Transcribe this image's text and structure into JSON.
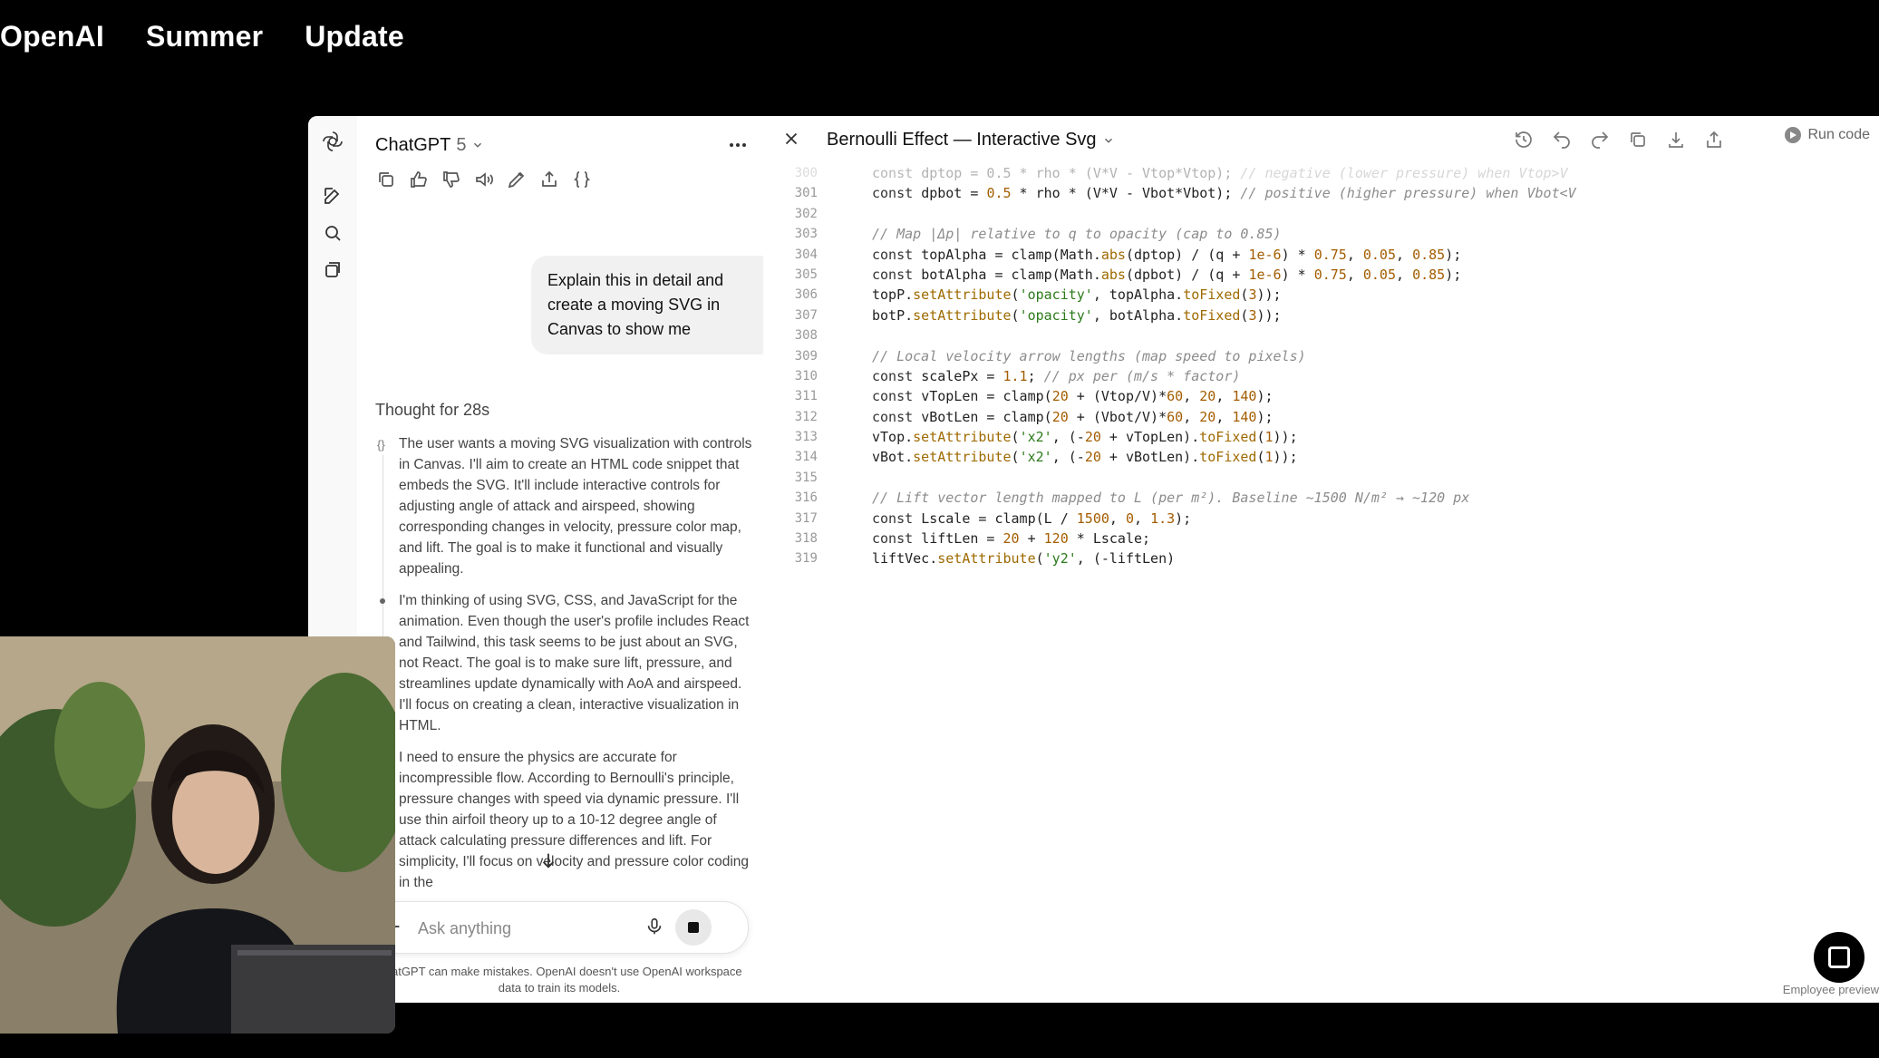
{
  "banner": {
    "words": [
      "OpenAI",
      "Summer",
      "Update"
    ]
  },
  "sidebar": {
    "icons": [
      "openai-logo-icon",
      "new-chat-icon",
      "search-icon",
      "library-icon"
    ]
  },
  "chat": {
    "model_name": "ChatGPT",
    "model_version": "5",
    "message_actions": [
      "copy-icon",
      "thumbs-up-icon",
      "thumbs-down-icon",
      "read-aloud-icon",
      "edit-icon",
      "share-icon",
      "code-icon"
    ],
    "user_message": "Explain this in detail and create a moving SVG in Canvas to show me",
    "thought_title": "Thought for 28s",
    "thoughts": [
      "The user wants a moving SVG visualization with controls in Canvas. I'll aim to create an HTML code snippet that embeds the SVG. It'll include interactive controls for adjusting angle of attack and airspeed, showing corresponding changes in velocity, pressure color map, and lift. The goal is to make it functional and visually appealing.",
      "I'm thinking of using SVG, CSS, and JavaScript for the animation. Even though the user's profile includes React and Tailwind, this task seems to be just about an SVG, not React. The goal is to make sure lift, pressure, and streamlines update dynamically with AoA and airspeed. I'll focus on creating a clean, interactive visualization in HTML.",
      "I need to ensure the physics are accurate for incompressible flow. According to Bernoulli's principle, pressure changes with speed via dynamic pressure. I'll use thin airfoil theory up to a 10-12 degree angle of attack calculating pressure differences and lift. For simplicity, I'll focus on velocity and pressure color coding in the"
    ],
    "composer_placeholder": "Ask anything",
    "disclaimer": "ChatGPT can make mistakes. OpenAI doesn't use OpenAI workspace data to train its models."
  },
  "canvas": {
    "title": "Bernoulli Effect — Interactive Svg",
    "toolbar_icons": [
      "history-icon",
      "undo-icon",
      "redo-icon",
      "copy-icon",
      "download-icon",
      "share-icon"
    ],
    "run_label": "Run code",
    "footer_note": "Employee preview",
    "code_lines": [
      {
        "n": "300",
        "faded": true,
        "t": [
          [
            "kw",
            "const "
          ],
          [
            "",
            "dptop = 0.5 * rho * (V*V - Vtop*Vtop); "
          ],
          [
            "com",
            "// negative (lower pressure) when Vtop>V"
          ]
        ]
      },
      {
        "n": "301",
        "t": [
          [
            "kw",
            "const "
          ],
          [
            "",
            "dpbot = "
          ],
          [
            "num",
            "0.5"
          ],
          [
            "",
            " * rho * (V*V - Vbot*Vbot); "
          ],
          [
            "com",
            "// positive (higher pressure) when Vbot<V"
          ]
        ]
      },
      {
        "n": "302",
        "t": []
      },
      {
        "n": "303",
        "t": [
          [
            "com",
            "// Map |Δp| relative to q to opacity (cap to 0.85)"
          ]
        ]
      },
      {
        "n": "304",
        "t": [
          [
            "kw",
            "const "
          ],
          [
            "",
            "topAlpha = clamp(Math."
          ],
          [
            "fn",
            "abs"
          ],
          [
            "",
            "(dptop) / (q + "
          ],
          [
            "num",
            "1e-6"
          ],
          [
            "",
            ") * "
          ],
          [
            "num",
            "0.75"
          ],
          [
            "",
            ", "
          ],
          [
            "num",
            "0.05"
          ],
          [
            "",
            ", "
          ],
          [
            "num",
            "0.85"
          ],
          [
            "",
            ");"
          ]
        ]
      },
      {
        "n": "305",
        "t": [
          [
            "kw",
            "const "
          ],
          [
            "",
            "botAlpha = clamp(Math."
          ],
          [
            "fn",
            "abs"
          ],
          [
            "",
            "(dpbot) / (q + "
          ],
          [
            "num",
            "1e-6"
          ],
          [
            "",
            ") * "
          ],
          [
            "num",
            "0.75"
          ],
          [
            "",
            ", "
          ],
          [
            "num",
            "0.05"
          ],
          [
            "",
            ", "
          ],
          [
            "num",
            "0.85"
          ],
          [
            "",
            ");"
          ]
        ]
      },
      {
        "n": "306",
        "t": [
          [
            "",
            "topP."
          ],
          [
            "fn",
            "setAttribute"
          ],
          [
            "",
            "("
          ],
          [
            "str",
            "'opacity'"
          ],
          [
            "",
            ", topAlpha."
          ],
          [
            "fn",
            "toFixed"
          ],
          [
            "",
            "("
          ],
          [
            "num",
            "3"
          ],
          [
            "",
            "));"
          ]
        ]
      },
      {
        "n": "307",
        "t": [
          [
            "",
            "botP."
          ],
          [
            "fn",
            "setAttribute"
          ],
          [
            "",
            "("
          ],
          [
            "str",
            "'opacity'"
          ],
          [
            "",
            ", botAlpha."
          ],
          [
            "fn",
            "toFixed"
          ],
          [
            "",
            "("
          ],
          [
            "num",
            "3"
          ],
          [
            "",
            "));"
          ]
        ]
      },
      {
        "n": "308",
        "t": []
      },
      {
        "n": "309",
        "t": [
          [
            "com",
            "// Local velocity arrow lengths (map speed to pixels)"
          ]
        ]
      },
      {
        "n": "310",
        "t": [
          [
            "kw",
            "const "
          ],
          [
            "",
            "scalePx = "
          ],
          [
            "num",
            "1.1"
          ],
          [
            "",
            "; "
          ],
          [
            "com",
            "// px per (m/s * factor)"
          ]
        ]
      },
      {
        "n": "311",
        "t": [
          [
            "kw",
            "const "
          ],
          [
            "",
            "vTopLen = clamp("
          ],
          [
            "num",
            "20"
          ],
          [
            "",
            " + (Vtop/V)*"
          ],
          [
            "num",
            "60"
          ],
          [
            "",
            ", "
          ],
          [
            "num",
            "20"
          ],
          [
            "",
            ", "
          ],
          [
            "num",
            "140"
          ],
          [
            "",
            ");"
          ]
        ]
      },
      {
        "n": "312",
        "t": [
          [
            "kw",
            "const "
          ],
          [
            "",
            "vBotLen = clamp("
          ],
          [
            "num",
            "20"
          ],
          [
            "",
            " + (Vbot/V)*"
          ],
          [
            "num",
            "60"
          ],
          [
            "",
            ", "
          ],
          [
            "num",
            "20"
          ],
          [
            "",
            ", "
          ],
          [
            "num",
            "140"
          ],
          [
            "",
            ");"
          ]
        ]
      },
      {
        "n": "313",
        "t": [
          [
            "",
            "vTop."
          ],
          [
            "fn",
            "setAttribute"
          ],
          [
            "",
            "("
          ],
          [
            "str",
            "'x2'"
          ],
          [
            "",
            ", (-"
          ],
          [
            "num",
            "20"
          ],
          [
            "",
            " + vTopLen)."
          ],
          [
            "fn",
            "toFixed"
          ],
          [
            "",
            "("
          ],
          [
            "num",
            "1"
          ],
          [
            "",
            "));"
          ]
        ]
      },
      {
        "n": "314",
        "t": [
          [
            "",
            "vBot."
          ],
          [
            "fn",
            "setAttribute"
          ],
          [
            "",
            "("
          ],
          [
            "str",
            "'x2'"
          ],
          [
            "",
            ", (-"
          ],
          [
            "num",
            "20"
          ],
          [
            "",
            " + vBotLen)."
          ],
          [
            "fn",
            "toFixed"
          ],
          [
            "",
            "("
          ],
          [
            "num",
            "1"
          ],
          [
            "",
            "));"
          ]
        ]
      },
      {
        "n": "315",
        "t": []
      },
      {
        "n": "316",
        "t": [
          [
            "com",
            "// Lift vector length mapped to L (per m²). Baseline ~1500 N/m² → ~120 px"
          ]
        ]
      },
      {
        "n": "317",
        "t": [
          [
            "kw",
            "const "
          ],
          [
            "",
            "Lscale = clamp(L / "
          ],
          [
            "num",
            "1500"
          ],
          [
            "",
            ", "
          ],
          [
            "num",
            "0"
          ],
          [
            "",
            ", "
          ],
          [
            "num",
            "1.3"
          ],
          [
            "",
            ");"
          ]
        ]
      },
      {
        "n": "318",
        "t": [
          [
            "kw",
            "const "
          ],
          [
            "",
            "liftLen = "
          ],
          [
            "num",
            "20"
          ],
          [
            "",
            " + "
          ],
          [
            "num",
            "120"
          ],
          [
            "",
            " * Lscale;"
          ]
        ]
      },
      {
        "n": "319",
        "t": [
          [
            "",
            "liftVec."
          ],
          [
            "fn",
            "setAttribute"
          ],
          [
            "",
            "("
          ],
          [
            "str",
            "'y2'"
          ],
          [
            "",
            ", (-liftLen)"
          ]
        ]
      }
    ]
  }
}
